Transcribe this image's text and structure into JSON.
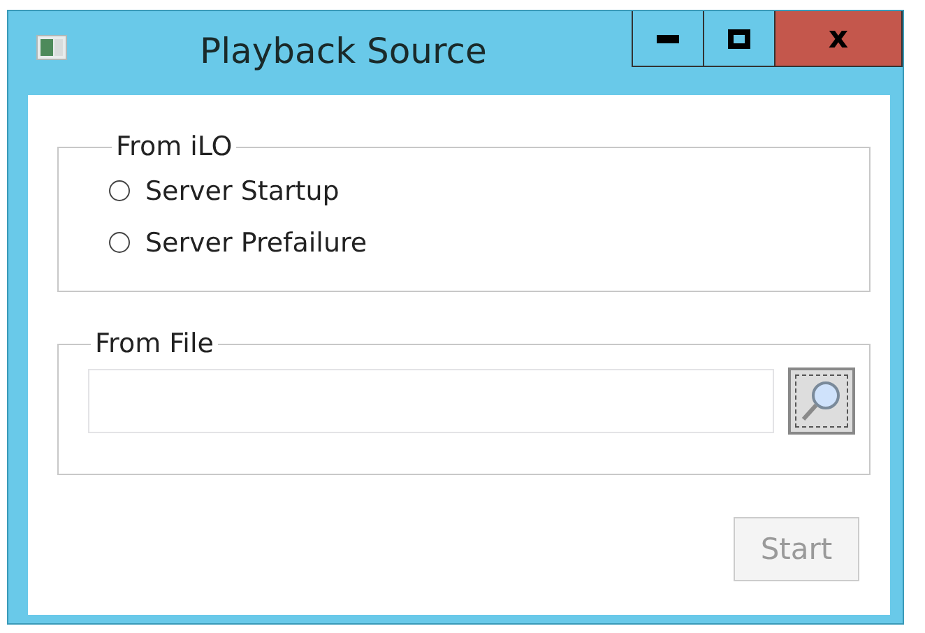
{
  "window": {
    "title": "Playback Source",
    "close_label": "x"
  },
  "ilo_group": {
    "legend": "From iLO",
    "options": [
      {
        "label": "Server Startup",
        "selected": false
      },
      {
        "label": "Server Prefailure",
        "selected": false
      }
    ]
  },
  "file_group": {
    "legend": "From File"
  },
  "start_button": {
    "label": "Start",
    "disabled": true
  }
}
